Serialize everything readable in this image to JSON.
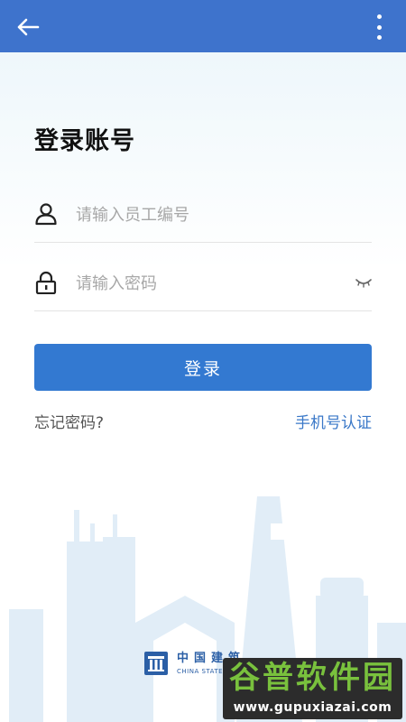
{
  "topbar": {
    "back_icon": "arrow-left-icon",
    "more_icon": "more-vertical-icon",
    "color": "#3e73cc"
  },
  "login": {
    "title": "登录账号",
    "username_placeholder": "请输入员工编号",
    "password_placeholder": "请输入密码",
    "submit_label": "登录",
    "forgot_label": "忘记密码?",
    "phone_auth_label": "手机号认证",
    "accent_color": "#3379d1"
  },
  "footer_logo": {
    "name_cn": "中国建筑",
    "name_en": "CHINA STATE C"
  },
  "watermark": {
    "name_cn": "谷普软件园",
    "url": "www.gupuxiazai.com"
  }
}
